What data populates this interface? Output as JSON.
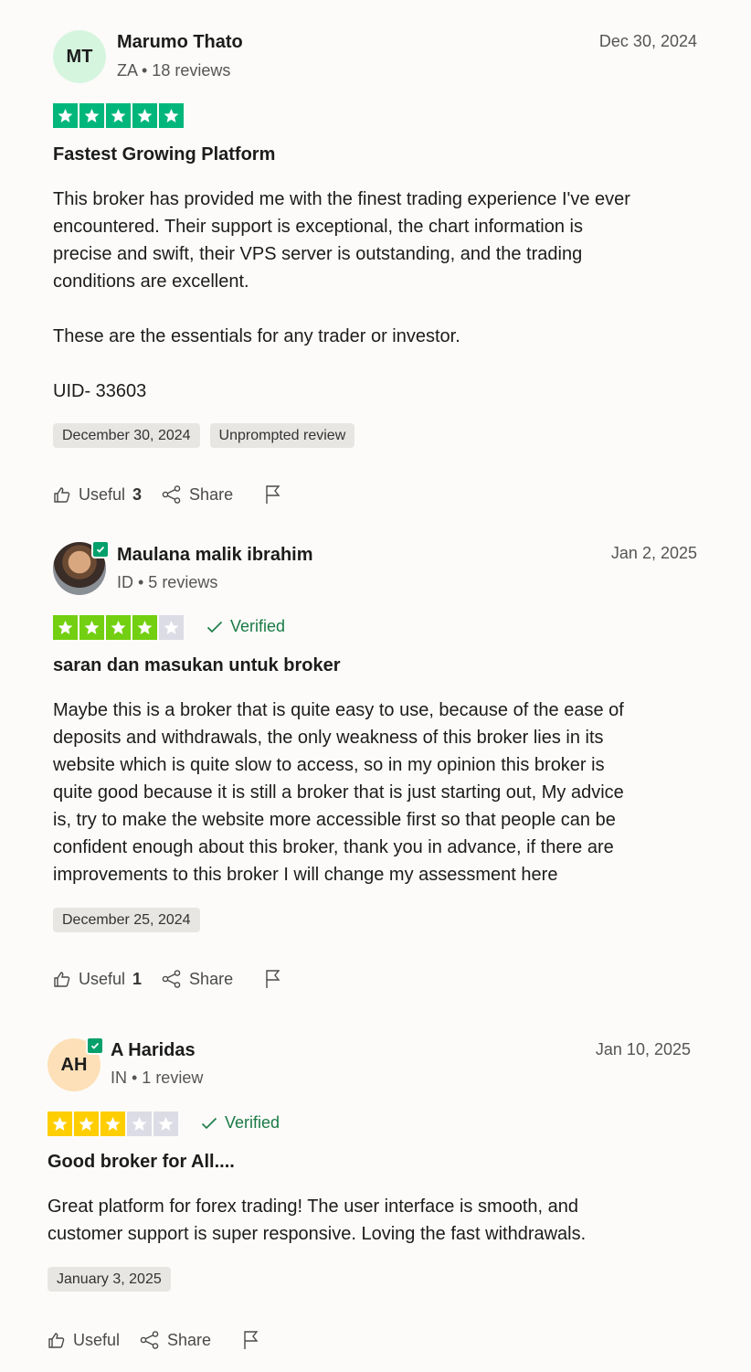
{
  "reviews": [
    {
      "initials": "MT",
      "avatar_color": "#d6f5df",
      "name": "Marumo Thato",
      "meta": "ZA • 18 reviews",
      "date": "Dec 30, 2024",
      "rating": 5,
      "star_color": "#00b67a",
      "verified": null,
      "title": "Fastest Growing Platform",
      "body": "This broker has provided me with the finest trading experience I've ever\nencountered. Their support is exceptional, the chart information is\nprecise and swift, their VPS server is outstanding, and the trading\nconditions are excellent.\n\nThese are the essentials for any trader or investor.\n\nUID- 33603",
      "tags": [
        "December 30, 2024",
        "Unprompted review"
      ],
      "useful_label": "Useful",
      "useful_count": "3",
      "share_label": "Share"
    },
    {
      "initials": "",
      "avatar_color": "#8a8f96",
      "name": "Maulana malik ibrahim",
      "meta": "ID • 5 reviews",
      "date": "Jan 2, 2025",
      "rating": 4,
      "star_color": "#73cf11",
      "verified": "Verified",
      "title": "saran dan masukan untuk broker",
      "body": "Maybe this is a broker that is quite easy to use, because of the ease of\ndeposits and withdrawals, the only weakness of this broker lies in its\nwebsite which is quite slow to access, so in my opinion this broker is\nquite good because it is still a broker that is just starting out, My advice\nis, try to make the website more accessible first so that people can be\nconfident enough about this broker, thank you in advance, if there are\nimprovements to this broker I will change my assessment here",
      "tags": [
        "December 25, 2024"
      ],
      "useful_label": "Useful",
      "useful_count": "1",
      "share_label": "Share"
    },
    {
      "initials": "AH",
      "avatar_color": "#fde0b8",
      "name": "A Haridas",
      "meta": "IN • 1 review",
      "date": "Jan 10, 2025",
      "rating": 3,
      "star_color": "#ffce00",
      "verified": "Verified",
      "title": "Good broker for All....",
      "body": "Great platform for forex trading! The user interface is smooth, and\ncustomer support is super responsive. Loving the fast withdrawals.",
      "tags": [
        "January 3, 2025"
      ],
      "useful_label": "Useful",
      "useful_count": "",
      "share_label": "Share"
    }
  ],
  "colors": {
    "empty_star": "#dcdce6",
    "verified_green": "#1a7a46",
    "badge_green": "#04a06b"
  },
  "icons": [
    "thumbs-up-icon",
    "share-icon",
    "flag-icon",
    "check-icon",
    "star-icon"
  ]
}
